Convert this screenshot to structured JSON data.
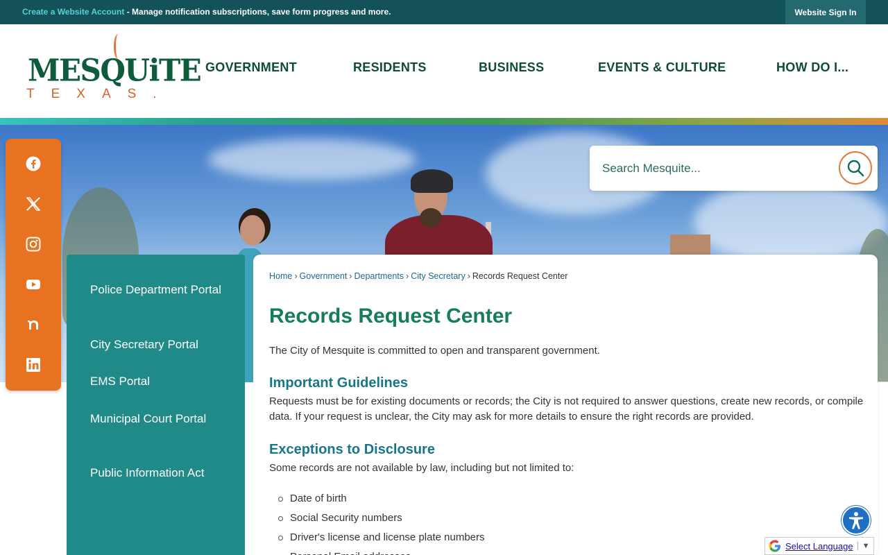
{
  "topbar": {
    "create_link": "Create a Website Account",
    "message": " - Manage notification subscriptions, save form progress and more.",
    "signin_label": "Website Sign In"
  },
  "logo": {
    "word": "MESQUiTE",
    "sub": "TEXAS."
  },
  "nav": {
    "items": [
      {
        "label": "GOVERNMENT"
      },
      {
        "label": "RESIDENTS"
      },
      {
        "label": "BUSINESS"
      },
      {
        "label": "EVENTS & CULTURE"
      },
      {
        "label": "HOW DO I..."
      }
    ]
  },
  "search": {
    "placeholder": "Search Mesquite..."
  },
  "social": {
    "icons": [
      "facebook-icon",
      "x-icon",
      "instagram-icon",
      "youtube-icon",
      "nextdoor-icon",
      "linkedin-icon"
    ]
  },
  "sidenav": {
    "items": [
      {
        "label": "Police Department Portal"
      },
      {
        "label": "City Secretary Portal"
      },
      {
        "label": "EMS Portal"
      },
      {
        "label": "Municipal Court Portal"
      },
      {
        "label": "Public Information Act"
      }
    ]
  },
  "breadcrumb": {
    "items": [
      "Home",
      "Government",
      "Departments",
      "City Secretary"
    ],
    "current": "Records Request Center",
    "separator": "›"
  },
  "content": {
    "title": "Records Request Center",
    "intro": "The City of Mesquite is committed to open and transparent government.",
    "guidelines_heading": "Important Guidelines",
    "guidelines_text": "Requests must be for existing documents or records; the City is not required to answer questions, create new records, or compile data. If your request is unclear, the City may ask for more details to ensure the right records are provided.",
    "exceptions_heading": "Exceptions to Disclosure",
    "exceptions_text": "Some records are not available by law, including but not limited to:",
    "exceptions_list": [
      "Date of birth",
      "Social Security numbers",
      "Driver's license and license plate numbers",
      "Personal Email addresses"
    ]
  },
  "translate": {
    "label": "Select Language",
    "arrow": "▼"
  },
  "colors": {
    "topbar": "#14525a",
    "brand_green": "#0f5c3d",
    "accent_orange": "#e8721f",
    "sidenav_teal": "#1f8a88",
    "title_green": "#157d5d",
    "heading_teal": "#17778a"
  }
}
